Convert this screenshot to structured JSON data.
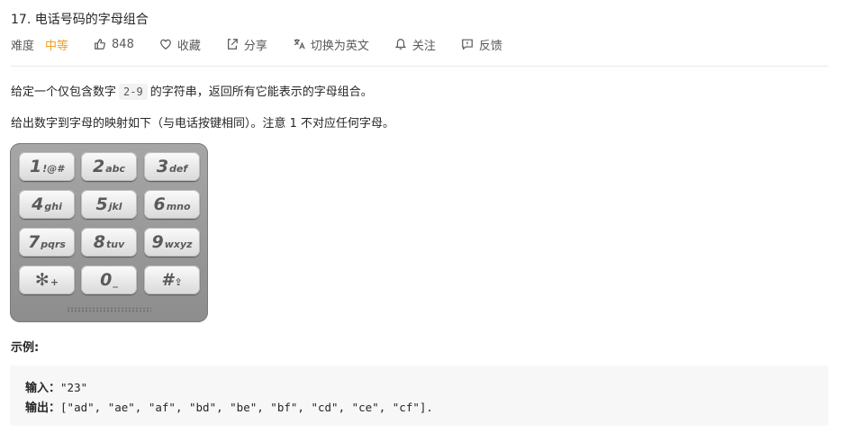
{
  "problem": {
    "title": "17. 电话号码的字母组合"
  },
  "meta": {
    "difficulty_label": "难度",
    "difficulty_value": "中等",
    "difficulty_color": "#f0a020",
    "likes": "848",
    "favorite": "收藏",
    "share": "分享",
    "switch_lang": "切换为英文",
    "follow": "关注",
    "feedback": "反馈",
    "icons": [
      "thumbs-up-icon",
      "heart-icon",
      "share-icon",
      "translate-icon",
      "bell-icon",
      "feedback-icon"
    ]
  },
  "description": {
    "p1_before": "给定一个仅包含数字",
    "p1_code": "2-9",
    "p1_after": "的字符串，返回所有它能表示的字母组合。",
    "p2": "给出数字到字母的映射如下（与电话按键相同）。注意 1 不对应任何字母。"
  },
  "keypad": {
    "keys": [
      {
        "digit": "1",
        "letters": "!@#"
      },
      {
        "digit": "2",
        "letters": "abc"
      },
      {
        "digit": "3",
        "letters": "def"
      },
      {
        "digit": "4",
        "letters": "ghi"
      },
      {
        "digit": "5",
        "letters": "jkl"
      },
      {
        "digit": "6",
        "letters": "mno"
      },
      {
        "digit": "7",
        "letters": "pqrs"
      },
      {
        "digit": "8",
        "letters": "tuv"
      },
      {
        "digit": "9",
        "letters": "wxyz"
      },
      {
        "digit": "✻",
        "letters": "+"
      },
      {
        "digit": "0",
        "letters": "_"
      },
      {
        "digit": "#",
        "letters": "⇪"
      }
    ]
  },
  "example": {
    "label": "示例:",
    "input_label": "输入：",
    "input_value": "\"23\"",
    "output_label": "输出：",
    "output_value": "[\"ad\", \"ae\", \"af\", \"bd\", \"be\", \"bf\", \"cd\", \"ce\", \"cf\"]."
  }
}
